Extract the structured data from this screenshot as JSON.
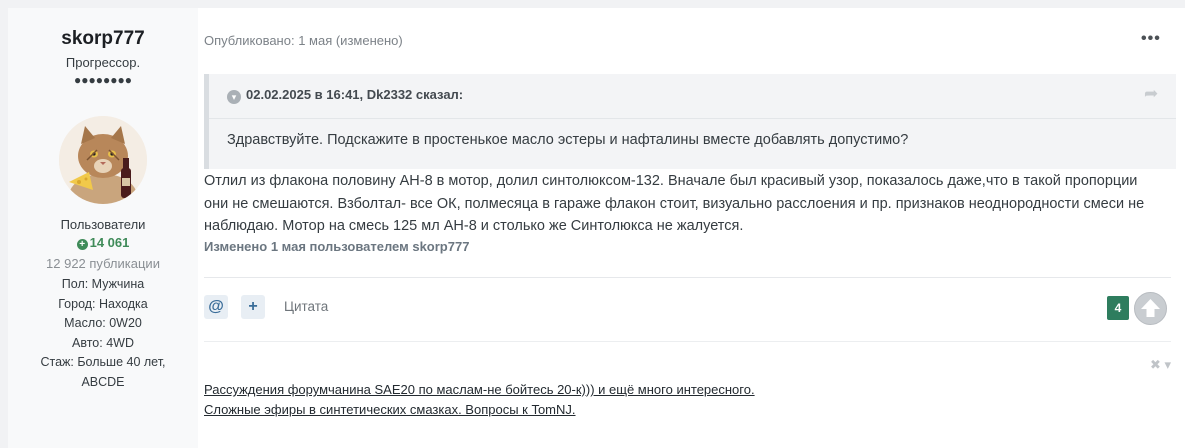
{
  "author": {
    "username": "skorp777",
    "rank": "Прогрессор.",
    "pips": "●●●●●●●●",
    "group": "Пользователи",
    "reputation": "14 061",
    "posts_count": "12 922 публикации",
    "fields": [
      "Пол: Мужчина",
      "Город: Находка",
      "Масло: 0W20",
      "Авто: 4WD",
      "Стаж: Больше 40 лет,",
      "ABCDE"
    ]
  },
  "post": {
    "published": "Опубликовано: 1 мая (изменено)",
    "more_icon": "ellipsis-icon",
    "quote": {
      "header": "02.02.2025 в 16:41, Dk2332 сказал:",
      "body": "Здравствуйте. Подскажите в простенькое масло эстеры и нафталины вместе добавлять допустимо?"
    },
    "text_lines": [
      "Отлил из флакона половину АН-8 в мотор, долил синтолюксом-132. Вначале был красивый узор, показалось даже,что в такой пропорции",
      "они не смешаются. Взболтал- все ОК, полмесяца в гараже флакон стоит, визуально расслоения и пр. признаков неоднородности смеси не",
      "наблюдаю. Мотор на смесь 125 мл АН-8 и столько же Синтолюкса не жалуется."
    ],
    "edited_note": "Изменено 1 мая пользователем skorp777",
    "actions": {
      "mention": "@",
      "add": "+",
      "quote_label": "Цитата"
    },
    "likes_count": "4",
    "close_glyph": "✖ ▾"
  },
  "signature": {
    "links": [
      "Рассуждения форумчанина SAE20 по маслам-не бойтесь 20-к))) и ещё много интересного.",
      "Сложные эфиры в синтетических смазках. Вопросы к TomNJ."
    ]
  },
  "colors": {
    "reputation_green": "#3f8b59",
    "badge_green": "#2e7d5e",
    "quote_bg": "#f3f4f6"
  }
}
